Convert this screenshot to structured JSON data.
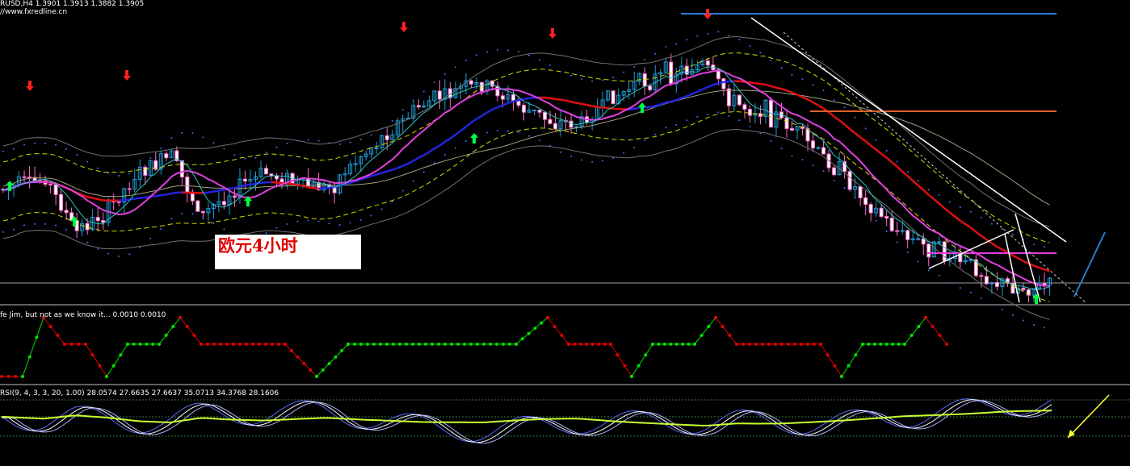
{
  "header": {
    "symbol_line": "RUSD,H4  1.3901 1.3913 1.3882 1.3905",
    "site": "//www.fxredline.cn"
  },
  "annotation": {
    "text": "欧元4小时"
  },
  "indicator1": {
    "label": "fe Jim, but not as we know it...  0.0010 0.0010"
  },
  "indicator2": {
    "label": "RSI(9, 4, 3, 3, 20, 1.00) 28.0574 27.6635 27.6637 35.0713 34.3768 28.1606"
  },
  "colors": {
    "background": "#000000",
    "bull_candle": "#1e9bd7",
    "bear_candle": "#ff6ec7",
    "red_ma": "#e01010",
    "blue_ma": "#2424e0",
    "magenta_ma": "#e040e0",
    "yellow_band": "#d8d800",
    "trend_white": "#ffffff",
    "resistance_blue": "#2a7fd4",
    "resistance_orange": "#e06030",
    "support_magenta": "#e040e0",
    "up_arrow": "#00ff40",
    "down_arrow": "#ff2020",
    "signal_green": "#00e000",
    "signal_red": "#e00000"
  },
  "chart_data": [
    {
      "type": "candlestick",
      "series_shape": [
        [
          0.0,
          0.62
        ],
        [
          0.04,
          0.58
        ],
        [
          0.07,
          0.78
        ],
        [
          0.1,
          0.7
        ],
        [
          0.13,
          0.55
        ],
        [
          0.16,
          0.5
        ],
        [
          0.19,
          0.72
        ],
        [
          0.22,
          0.62
        ],
        [
          0.25,
          0.56
        ],
        [
          0.28,
          0.6
        ],
        [
          0.31,
          0.62
        ],
        [
          0.34,
          0.5
        ],
        [
          0.37,
          0.4
        ],
        [
          0.4,
          0.3
        ],
        [
          0.43,
          0.25
        ],
        [
          0.46,
          0.22
        ],
        [
          0.49,
          0.3
        ],
        [
          0.52,
          0.36
        ],
        [
          0.55,
          0.38
        ],
        [
          0.58,
          0.28
        ],
        [
          0.61,
          0.22
        ],
        [
          0.64,
          0.18
        ],
        [
          0.67,
          0.15
        ],
        [
          0.7,
          0.3
        ],
        [
          0.72,
          0.32
        ],
        [
          0.74,
          0.35
        ],
        [
          0.77,
          0.45
        ],
        [
          0.8,
          0.56
        ],
        [
          0.83,
          0.68
        ],
        [
          0.86,
          0.8
        ],
        [
          0.89,
          0.85
        ],
        [
          0.92,
          0.9
        ],
        [
          0.95,
          0.97
        ],
        [
          0.97,
          0.99
        ],
        [
          1.0,
          0.98
        ]
      ],
      "markers": {
        "up_arrows": 7,
        "down_arrows": 5
      }
    },
    {
      "type": "step-signal",
      "values": [
        [
          0.0,
          0.0
        ],
        [
          0.02,
          0.0
        ],
        [
          0.04,
          1.0
        ],
        [
          0.06,
          0.55
        ],
        [
          0.08,
          0.55
        ],
        [
          0.1,
          0.0
        ],
        [
          0.12,
          0.55
        ],
        [
          0.15,
          0.55
        ],
        [
          0.17,
          1.0
        ],
        [
          0.19,
          0.55
        ],
        [
          0.27,
          0.55
        ],
        [
          0.3,
          0.0
        ],
        [
          0.33,
          0.55
        ],
        [
          0.49,
          0.55
        ],
        [
          0.52,
          1.0
        ],
        [
          0.54,
          0.55
        ],
        [
          0.58,
          0.55
        ],
        [
          0.6,
          0.0
        ],
        [
          0.62,
          0.55
        ],
        [
          0.66,
          0.55
        ],
        [
          0.68,
          1.0
        ],
        [
          0.7,
          0.55
        ],
        [
          0.78,
          0.55
        ],
        [
          0.8,
          0.0
        ],
        [
          0.82,
          0.55
        ],
        [
          0.86,
          0.55
        ],
        [
          0.88,
          1.0
        ],
        [
          0.9,
          0.55
        ],
        [
          1.2,
          0.55
        ]
      ]
    },
    {
      "type": "oscillator",
      "levels": [
        20,
        50,
        80
      ],
      "last_values": [
        28.0574,
        27.6635,
        27.6637,
        35.0713,
        34.3768,
        28.1606
      ]
    }
  ]
}
